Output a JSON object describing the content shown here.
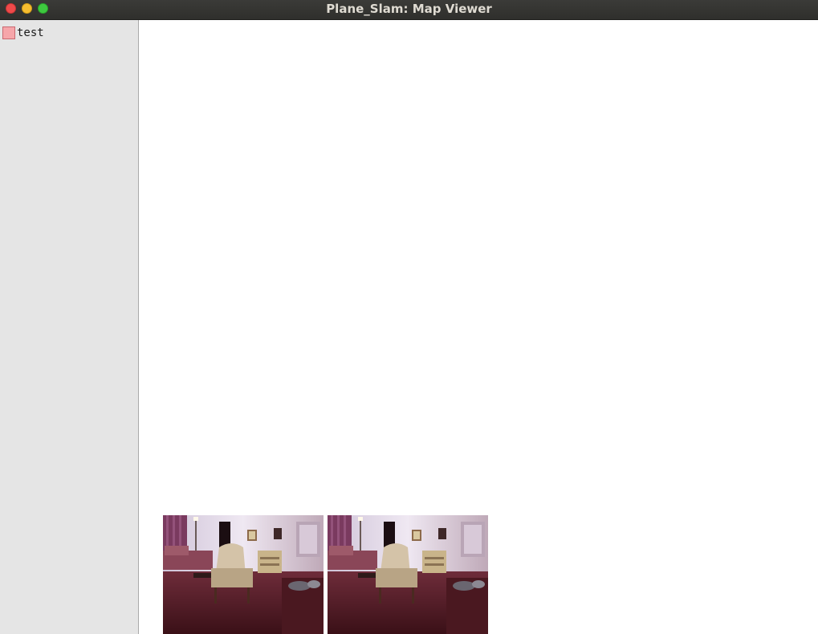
{
  "window": {
    "title": "Plane_Slam: Map Viewer",
    "controls": [
      "close",
      "minimize",
      "maximize"
    ]
  },
  "sidebar": {
    "layers": [
      {
        "label": "test",
        "color": "#f6a6aa"
      }
    ]
  },
  "map_view": {
    "camera_images": [
      {
        "icon": "camera-frame-image"
      },
      {
        "icon": "camera-frame-image"
      }
    ]
  }
}
